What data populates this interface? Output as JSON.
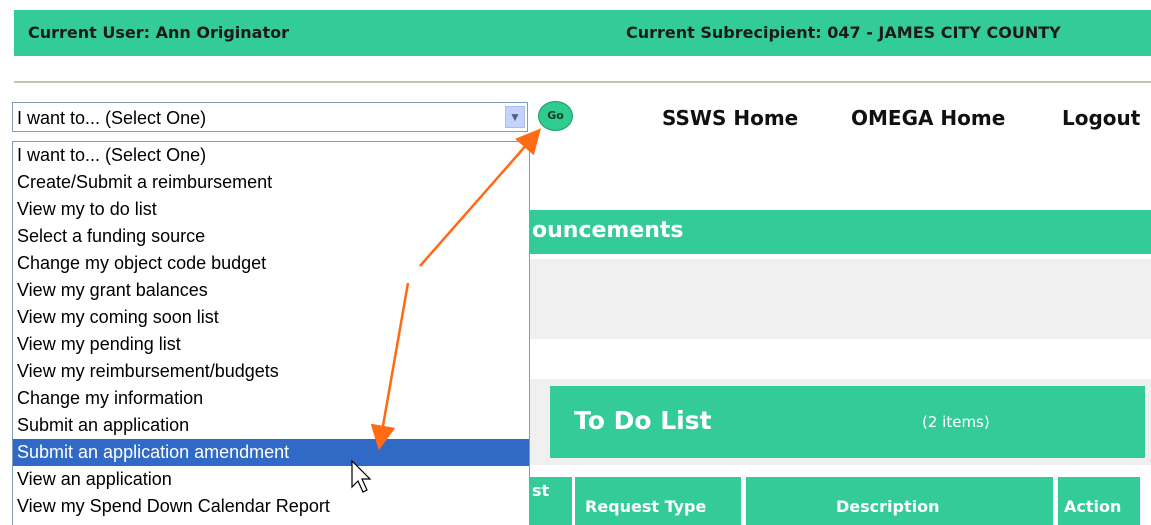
{
  "header": {
    "current_user": "Current User: Ann Originator",
    "current_subrecipient": "Current Subrecipient: 047 - JAMES CITY COUNTY"
  },
  "action_select": {
    "selected": "I want to... (Select One)",
    "go_label": "Go",
    "options": [
      "I want to... (Select One)",
      "Create/Submit a reimbursement",
      "View my to do list",
      "Select a funding source",
      "Change my object code budget",
      "View my grant balances",
      "View my coming soon list",
      "View my pending list",
      "View my reimbursement/budgets",
      "Change my information",
      "Submit an application",
      "Submit an application amendment",
      "View an application",
      "View my Spend Down Calendar Report"
    ],
    "highlighted_index": 11
  },
  "nav": {
    "ssws_home": "SSWS Home",
    "omega_home": "OMEGA Home",
    "logout": "Logout"
  },
  "announcements": {
    "title": "ouncements"
  },
  "todo": {
    "title": "To Do List",
    "count": "(2 items)",
    "columns": [
      "st",
      "Request Type",
      "Description",
      "Action"
    ]
  },
  "colors": {
    "accent_green": "#33cc99",
    "highlight_blue": "#3169c6",
    "annotation_orange": "#ff6a13"
  }
}
